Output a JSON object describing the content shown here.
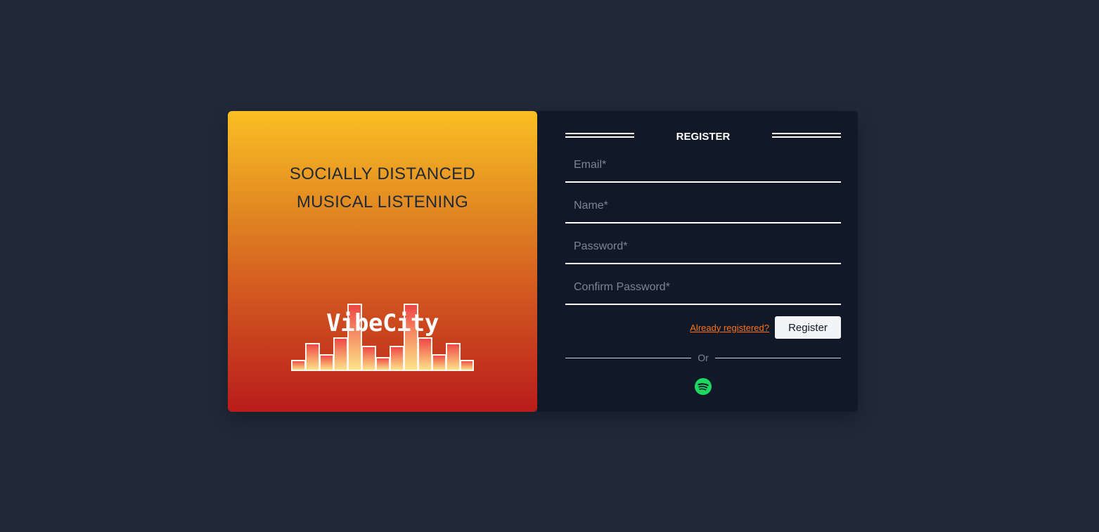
{
  "hero": {
    "tagline_line1": "SOCIALLY DISTANCED",
    "tagline_line2": "MUSICAL LISTENING",
    "logo_text": "VibeCity"
  },
  "form": {
    "title": "REGISTER",
    "fields": [
      {
        "placeholder": "Email*",
        "value": ""
      },
      {
        "placeholder": "Name*",
        "value": ""
      },
      {
        "placeholder": "Password*",
        "value": ""
      },
      {
        "placeholder": "Confirm Password*",
        "value": ""
      }
    ],
    "already_registered_link": "Already registered?",
    "register_button": "Register",
    "divider_text": "Or",
    "social_icon": "spotify-icon"
  },
  "colors": {
    "page_background": "#202938",
    "panel_background": "#111827",
    "gradient_top": "#fbbf24",
    "gradient_bottom": "#b91c1c",
    "link": "#f97316",
    "spotify_green": "#1ed760"
  }
}
